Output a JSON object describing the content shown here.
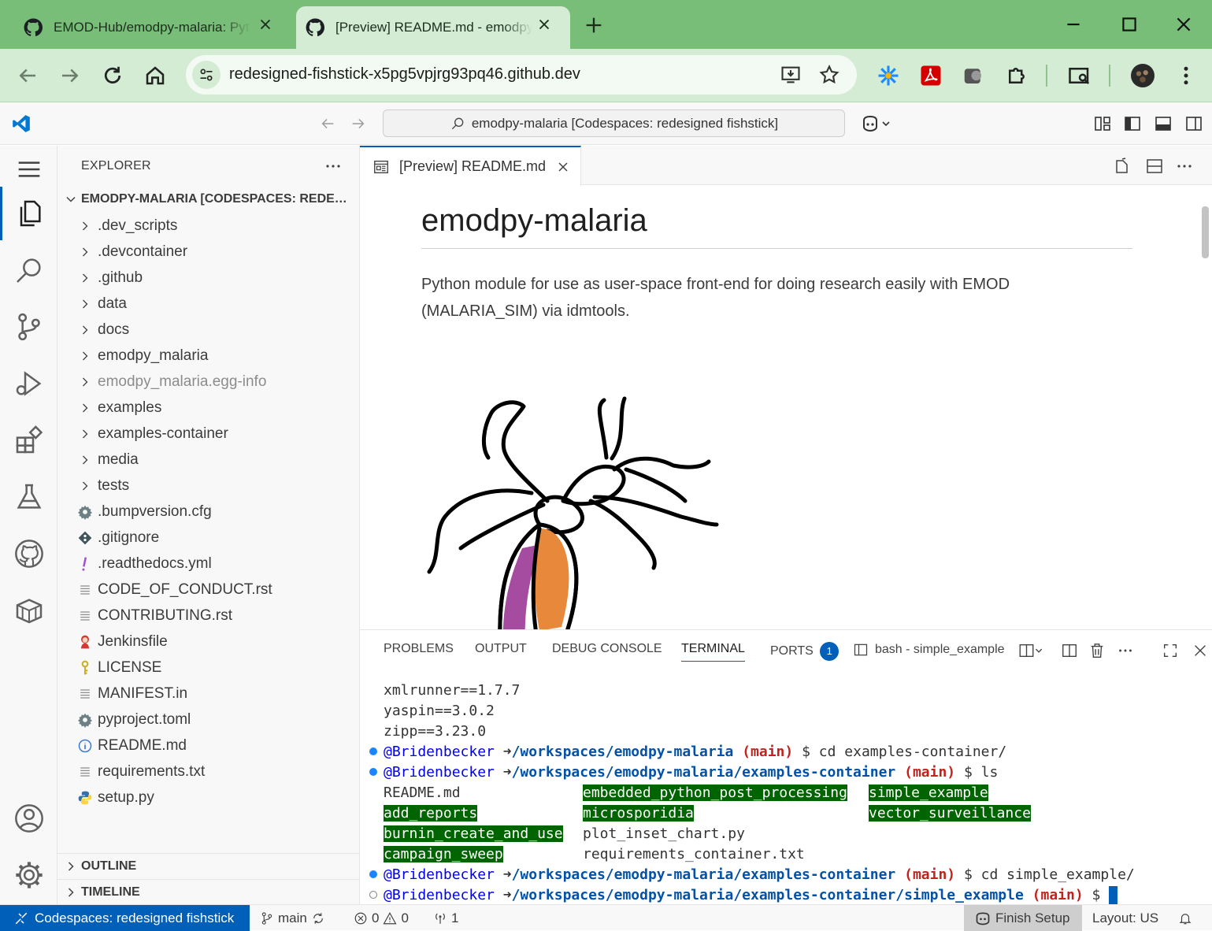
{
  "browser": {
    "tabs": [
      {
        "title": "EMOD-Hub/emodpy-malaria: Python module",
        "favicon": "github-icon",
        "active": false
      },
      {
        "title": "[Preview] README.md - emodpy-malaria",
        "favicon": "github-icon",
        "active": true
      }
    ],
    "url": "redesigned-fishstick-x5pg5vpjrg93pq46.github.dev",
    "accent": "#78bd78"
  },
  "vscode": {
    "command_center": "emodpy-malaria [Codespaces: redesigned fishstick]",
    "explorer": {
      "title": "EXPLORER",
      "root": "EMODPY-MALARIA [CODESPACES: REDESIGNED FISHSTICK]",
      "folders": [
        ".dev_scripts",
        ".devcontainer",
        ".github",
        "data",
        "docs",
        "emodpy_malaria",
        "emodpy_malaria.egg-info",
        "examples",
        "examples-container",
        "media",
        "tests"
      ],
      "files": [
        {
          "name": ".bumpversion.cfg",
          "icon": "gear-icon"
        },
        {
          "name": ".gitignore",
          "icon": "git-icon"
        },
        {
          "name": ".readthedocs.yml",
          "icon": "exclamation-icon"
        },
        {
          "name": "CODE_OF_CONDUCT.rst",
          "icon": "lines-icon"
        },
        {
          "name": "CONTRIBUTING.rst",
          "icon": "lines-icon"
        },
        {
          "name": "Jenkinsfile",
          "icon": "jenkins-icon"
        },
        {
          "name": "LICENSE",
          "icon": "key-icon"
        },
        {
          "name": "MANIFEST.in",
          "icon": "lines-icon"
        },
        {
          "name": "pyproject.toml",
          "icon": "gear-icon"
        },
        {
          "name": "README.md",
          "icon": "info-icon"
        },
        {
          "name": "requirements.txt",
          "icon": "lines-icon"
        },
        {
          "name": "setup.py",
          "icon": "python-icon"
        }
      ],
      "outline": "OUTLINE",
      "timeline": "TIMELINE"
    },
    "editor_tab": "[Preview] README.md",
    "preview": {
      "heading": "emodpy-malaria",
      "paragraph": "Python module for use as user-space front-end for doing research easily with EMOD (MALARIA_SIM) via idmtools."
    },
    "panel": {
      "tabs": {
        "problems": "PROBLEMS",
        "output": "OUTPUT",
        "debug": "DEBUG CONSOLE",
        "terminal": "TERMINAL",
        "ports": "PORTS"
      },
      "ports_count": "1",
      "terminal_name": "bash - simple_example"
    },
    "terminal": {
      "pre_lines": [
        "xmlrunner==1.7.7",
        "yaspin==3.0.2",
        "zipp==3.23.0"
      ],
      "user": "@Bridenbecker",
      "arrow": "➜",
      "branch_open": "(",
      "branch": "main",
      "branch_close": ")",
      "prompt": "$",
      "cmd1_path": "/workspaces/emodpy-malaria",
      "cmd1": "cd examples-container/",
      "cmd2_path": "/workspaces/emodpy-malaria/examples-container",
      "cmd2": "ls",
      "ls_col1": [
        "README.md",
        "add_reports",
        "burnin_create_and_use",
        "campaign_sweep"
      ],
      "ls_col2": [
        "embedded_python_post_processing",
        "microsporidia",
        "plot_inset_chart.py",
        "requirements_container.txt"
      ],
      "ls_col3": [
        "simple_example",
        "vector_surveillance"
      ],
      "cmd3_path": "/workspaces/emodpy-malaria/examples-container",
      "cmd3": "cd simple_example/",
      "cmd4_path": "/workspaces/emodpy-malaria/examples-container/simple_example"
    },
    "status": {
      "remote": "Codespaces: redesigned fishstick",
      "branch": "main",
      "errors": "0",
      "warnings": "0",
      "ports": "1",
      "finish_setup": "Finish Setup",
      "layout": "Layout: US"
    },
    "accent": "#005fb8"
  }
}
